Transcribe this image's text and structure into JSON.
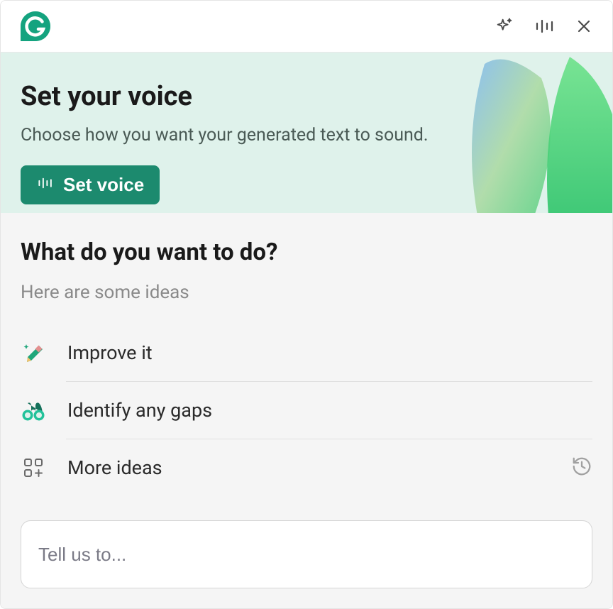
{
  "header": {
    "sparkle_icon": "sparkle-icon",
    "soundbars_icon": "soundbars-icon",
    "close_icon": "close-icon"
  },
  "voice_banner": {
    "title": "Set your voice",
    "subtitle": "Choose how you want your generated text to sound.",
    "button_label": "Set voice"
  },
  "main": {
    "title": "What do you want to do?",
    "ideas_caption": "Here are some ideas",
    "ideas": [
      {
        "icon": "pencil-sparkle",
        "label": "Improve it"
      },
      {
        "icon": "binoculars",
        "label": "Identify any gaps"
      }
    ],
    "more_ideas_label": "More ideas",
    "input_placeholder": "Tell us to..."
  },
  "colors": {
    "brand": "#14a37f",
    "banner_bg": "#dff2eb",
    "button_bg": "#1c8a6e"
  }
}
